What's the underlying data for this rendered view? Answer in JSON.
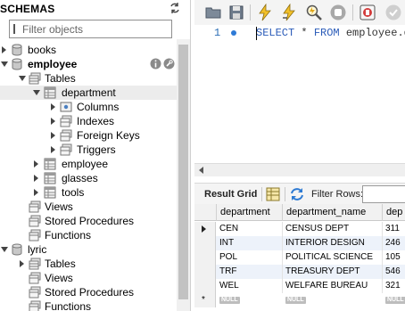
{
  "navigator": {
    "title": "SCHEMAS",
    "filter_placeholder": "Filter objects",
    "tree": [
      {
        "label": "books"
      },
      {
        "label": "employee"
      },
      {
        "label": "Tables"
      },
      {
        "label": "department"
      },
      {
        "label": "Columns"
      },
      {
        "label": "Indexes"
      },
      {
        "label": "Foreign Keys"
      },
      {
        "label": "Triggers"
      },
      {
        "label": "employee"
      },
      {
        "label": "glasses"
      },
      {
        "label": "tools"
      },
      {
        "label": "Views"
      },
      {
        "label": "Stored Procedures"
      },
      {
        "label": "Functions"
      },
      {
        "label": "lyric"
      },
      {
        "label": "Tables"
      },
      {
        "label": "Views"
      },
      {
        "label": "Stored Procedures"
      },
      {
        "label": "Functions"
      }
    ]
  },
  "editor": {
    "line_number": "1",
    "code_keyword1": "SELECT",
    "code_mid": " * ",
    "code_keyword2": "FROM",
    "code_rest": " employee.d"
  },
  "result_grid": {
    "label": "Result Grid",
    "filter_label": "Filter Rows:",
    "columns": [
      "department",
      "department_name",
      "dep"
    ],
    "rows": [
      [
        "CEN",
        "CENSUS DEPT",
        "311"
      ],
      [
        "INT",
        "INTERIOR DESIGN",
        "246"
      ],
      [
        "POL",
        "POLITICAL SCIENCE",
        "105"
      ],
      [
        "TRF",
        "TREASURY DEPT",
        "546"
      ],
      [
        "WEL",
        "WELFARE BUREAU",
        "321"
      ]
    ],
    "null_label": "NULL"
  },
  "colors": {
    "keyword": "#2a5bb8",
    "alt_row": "#edf2fa",
    "selected_tree_row": "#ececec"
  }
}
